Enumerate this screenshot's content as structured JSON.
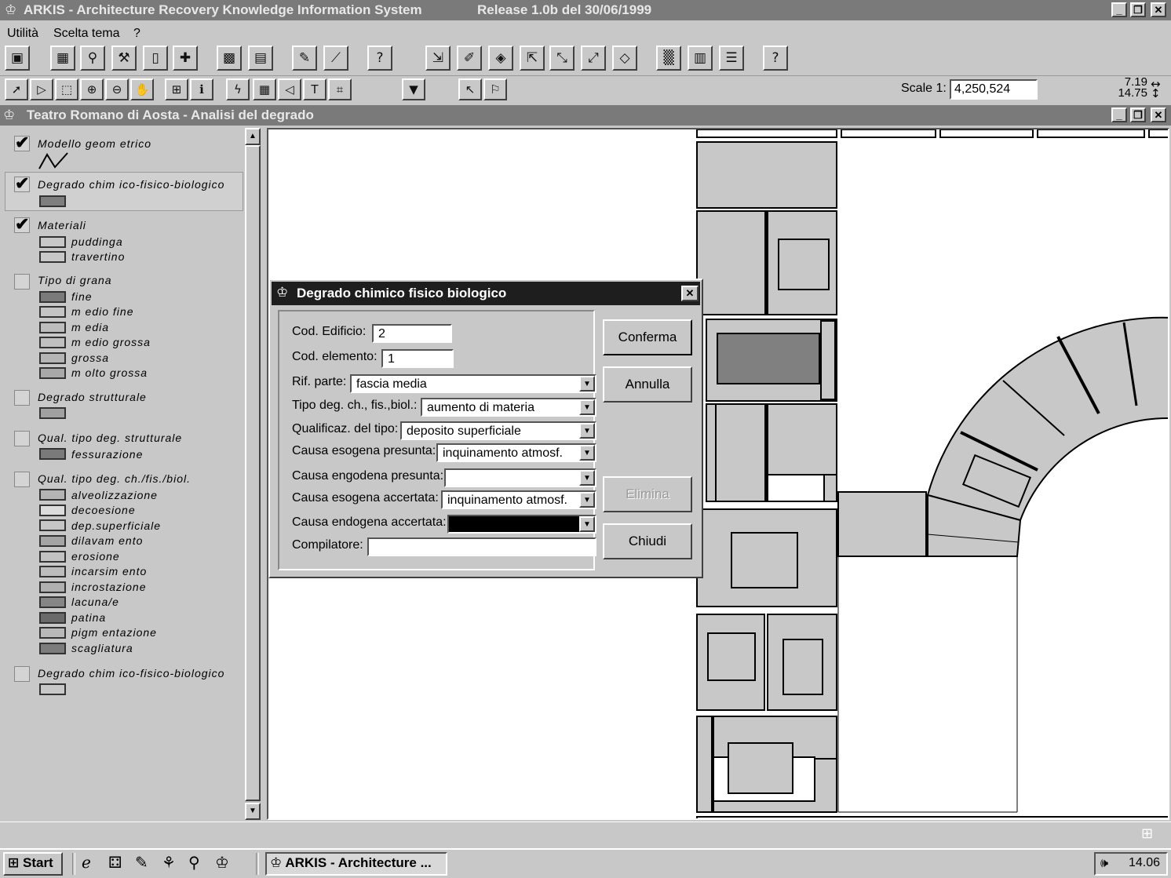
{
  "app": {
    "title": "ARKIS - Architecture Recovery Knowledge Information System",
    "release": "Release 1.0b   del 30/06/1999"
  },
  "menu": [
    "Utilità",
    "Scelta tema",
    "?"
  ],
  "toolbar": {
    "scale_label": "Scale 1:",
    "scale_value": "4,250,524",
    "coord_x": "7.19",
    "coord_y": "14.75"
  },
  "doc_window": {
    "title": "Teatro Romano di Aosta - Analisi del degrado"
  },
  "legend": [
    {
      "title": "Modello geom etrico",
      "checked": true,
      "items": []
    },
    {
      "title": "Degrado chim ico-fisico-biologico",
      "checked": true,
      "items": []
    },
    {
      "title": "Materiali",
      "checked": true,
      "items": [
        "puddinga",
        "travertino"
      ]
    },
    {
      "title": "Tipo di grana",
      "checked": false,
      "items": [
        "fine",
        "m edio  fine",
        "m edia",
        "m edio  grossa",
        "grossa",
        "m olto  grossa"
      ]
    },
    {
      "title": "Degrado strutturale",
      "checked": false,
      "items": []
    },
    {
      "title": "Qual. tipo deg. strutturale",
      "checked": false,
      "items": [
        "fessurazione"
      ]
    },
    {
      "title": "Qual. tipo deg. ch./fis./biol.",
      "checked": false,
      "items": [
        "alveolizzazione",
        "decoesione",
        "dep.superficiale",
        "dilavam ento",
        "erosione",
        "incarsim ento",
        "incrostazione",
        "lacuna/e",
        "patina",
        "pigm entazione",
        "scagliatura"
      ]
    },
    {
      "title": "Degrado chim ico-fisico-biologico",
      "checked": false,
      "items": []
    }
  ],
  "dialog": {
    "title": "Degrado chimico fisico biologico",
    "fields": {
      "cod_edificio": {
        "label": "Cod. Edificio:",
        "value": "2"
      },
      "cod_elemento": {
        "label": "Cod. elemento:",
        "value": "1"
      },
      "rif_parte": {
        "label": "Rif. parte:",
        "value": "fascia media"
      },
      "tipo_deg": {
        "label": "Tipo deg. ch., fis.,biol.:",
        "value": "aumento di materia"
      },
      "qualificaz": {
        "label": "Qualificaz. del tipo:",
        "value": "deposito superficiale"
      },
      "causa_eso_pres": {
        "label": "Causa esogena presunta:",
        "value": "inquinamento atmosf."
      },
      "causa_endo_pres": {
        "label": "Causa engodena presunta:",
        "value": ""
      },
      "causa_eso_acc": {
        "label": "Causa esogena accertata:",
        "value": "inquinamento atmosf."
      },
      "causa_endo_acc": {
        "label": "Causa endogena accertata:",
        "value": ""
      },
      "compilatore": {
        "label": "Compilatore:",
        "value": ""
      }
    },
    "buttons": {
      "confirm": "Conferma",
      "cancel": "Annulla",
      "delete": "Elimina",
      "close": "Chiudi"
    }
  },
  "taskbar": {
    "start": "Start",
    "task": "ARKIS - Architecture ...",
    "clock": "14.06"
  }
}
